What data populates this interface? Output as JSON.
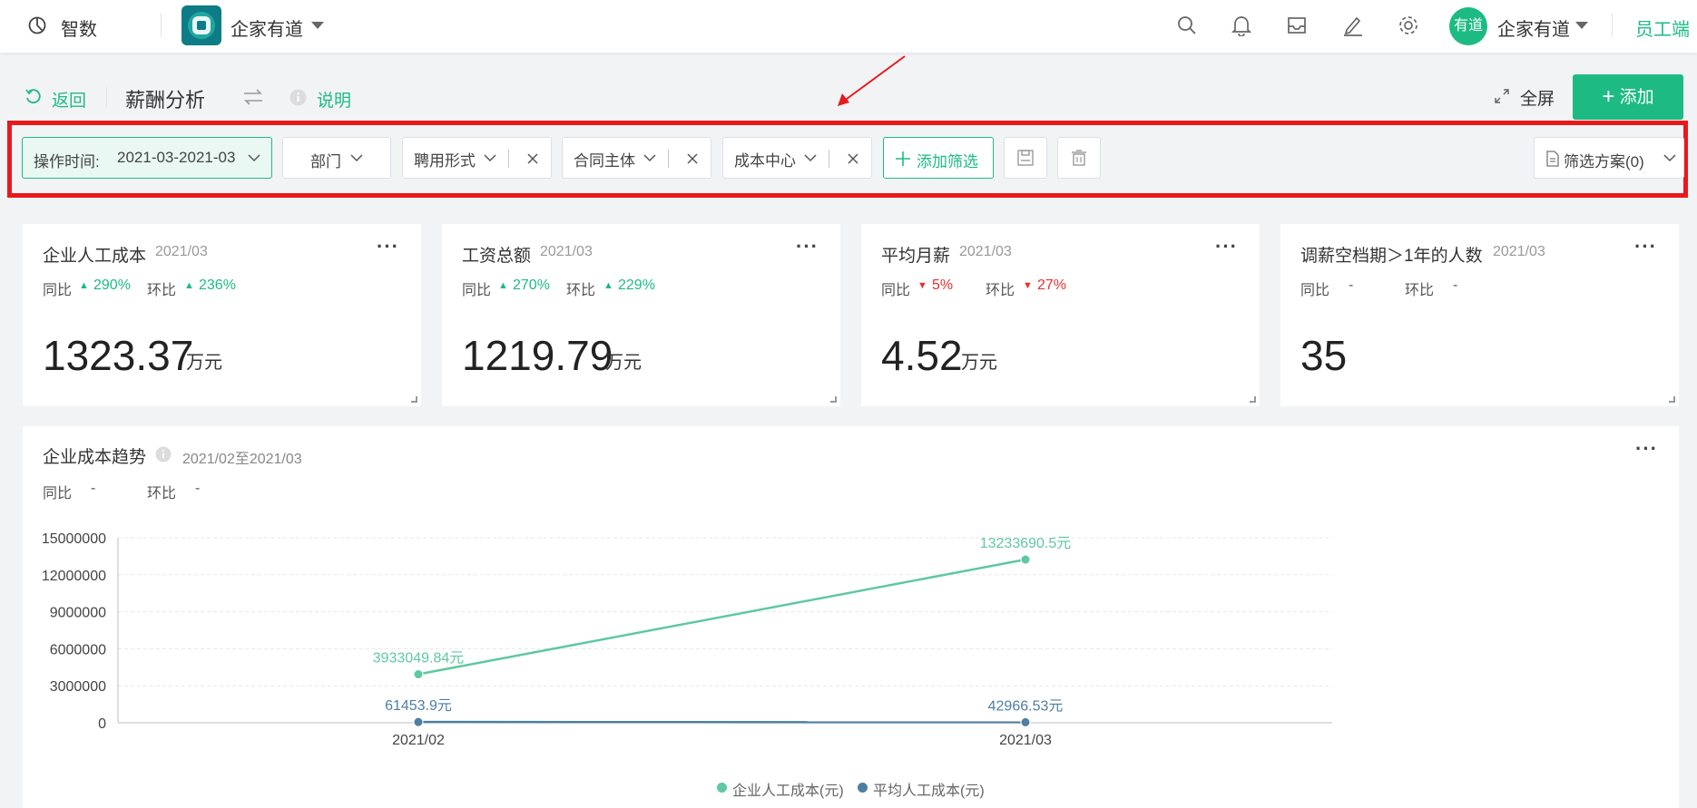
{
  "topbar": {
    "app_name": "智数",
    "org_name": "企家有道",
    "avatar_text": "有道",
    "user_name": "企家有道",
    "employee_link": "员工端",
    "icons": [
      "pie-chart-icon",
      "search-icon",
      "bell-icon",
      "inbox-icon",
      "edit-icon",
      "gear-icon",
      "caret-down-icon"
    ]
  },
  "nav": {
    "back": "返回",
    "title": "薪酬分析",
    "help": "说明",
    "fullscreen": "全屏",
    "add": "添加"
  },
  "filters": {
    "time_label": "操作时间:",
    "time_value": "2021-03-2021-03",
    "department": "部门",
    "employment": "聘用形式",
    "contract": "合同主体",
    "cost_center": "成本中心",
    "add_filter": "添加筛选",
    "scheme": "筛选方案(0)"
  },
  "cards": [
    {
      "title": "企业人工成本",
      "date": "2021/03",
      "yoy_label": "同比",
      "yoy": "290%",
      "yoy_dir": "up",
      "mom_label": "环比",
      "mom": "236%",
      "mom_dir": "up",
      "value": "1323.37",
      "unit": "万元"
    },
    {
      "title": "工资总额",
      "date": "2021/03",
      "yoy_label": "同比",
      "yoy": "270%",
      "yoy_dir": "up",
      "mom_label": "环比",
      "mom": "229%",
      "mom_dir": "up",
      "value": "1219.79",
      "unit": "万元"
    },
    {
      "title": "平均月薪",
      "date": "2021/03",
      "yoy_label": "同比",
      "yoy": "5%",
      "yoy_dir": "down",
      "mom_label": "环比",
      "mom": "27%",
      "mom_dir": "down",
      "value": "4.52",
      "unit": "万元"
    },
    {
      "title": "调薪空档期＞1年的人数",
      "date": "2021/03",
      "yoy_label": "同比",
      "yoy": "-",
      "mom_label": "环比",
      "mom": "-",
      "value": "35",
      "unit": ""
    }
  ],
  "trend": {
    "title": "企业成本趋势",
    "period": "2021/02至2021/03",
    "yoy_label": "同比",
    "yoy": "-",
    "mom_label": "环比",
    "mom": "-"
  },
  "chart_data": {
    "type": "line",
    "categories": [
      "2021/02",
      "2021/03"
    ],
    "ylim": [
      0,
      15000000
    ],
    "yticks": [
      "0",
      "3000000",
      "6000000",
      "9000000",
      "12000000",
      "15000000"
    ],
    "ytick_values": [
      0,
      3000000,
      6000000,
      9000000,
      12000000,
      15000000
    ],
    "grid": true,
    "legend_position": "bottom",
    "series": [
      {
        "name": "企业人工成本(元)",
        "values": [
          3933049.84,
          13233690.5
        ],
        "labels": [
          "3933049.84元",
          "13233690.5元"
        ],
        "color": "#5ec8a0"
      },
      {
        "name": "平均人工成本(元)",
        "values": [
          61453.9,
          42966.53
        ],
        "labels": [
          "61453.9元",
          "42966.53元"
        ],
        "color": "#4e7ea1"
      }
    ]
  },
  "colors": {
    "accent": "#1dbb83",
    "down": "#e8302f",
    "highlight_box": "#e8191b"
  }
}
